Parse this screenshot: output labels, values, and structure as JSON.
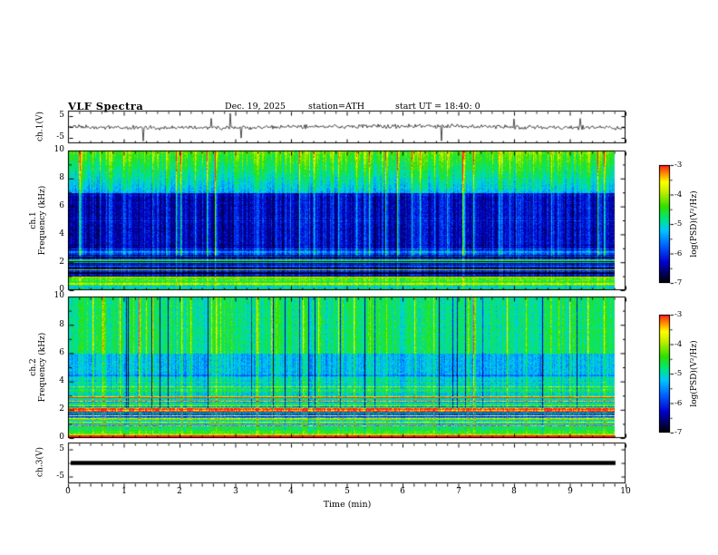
{
  "title": "VLF Spectra",
  "header": {
    "date": "Dec. 19, 2025",
    "station": "station=ATH",
    "start_ut": "start UT =  18:40: 0"
  },
  "x_axis": {
    "label": "Time (min)",
    "min": 0,
    "max": 10,
    "ticks": [
      "0",
      "1",
      "2",
      "3",
      "4",
      "5",
      "6",
      "7",
      "8",
      "9",
      "10"
    ]
  },
  "panels": [
    {
      "id": "ch1-waveform",
      "ylabel": "ch.1(V)",
      "ytick_top": "5",
      "ytick_bottom": "-5",
      "y_min": -5,
      "y_max": 5
    },
    {
      "id": "ch1-spectrogram",
      "name": "ch.1",
      "ylabel": "Frequency (kHz)",
      "yticks": [
        "10",
        "8",
        "6",
        "4",
        "2",
        "0"
      ],
      "f_min": 0,
      "f_max": 10
    },
    {
      "id": "ch2-spectrogram",
      "name": "ch.2",
      "ylabel": "Frequency (kHz)",
      "yticks": [
        "10",
        "8",
        "6",
        "4",
        "2",
        "0"
      ],
      "f_min": 0,
      "f_max": 10
    },
    {
      "id": "ch3-waveform",
      "ylabel": "ch.3(V)",
      "ytick_top": "5",
      "ytick_bottom": "-5",
      "y_min": -5,
      "y_max": 5,
      "value": 0
    }
  ],
  "colorbar": {
    "label": "log(PSD)(V²/Hz)",
    "ticks": [
      "-3",
      "-4",
      "-5",
      "-6",
      "-7"
    ],
    "z_min": -7,
    "z_max": -3
  },
  "colors": {
    "background": "#ffffff",
    "frame": "#000000",
    "trace": "#000000"
  },
  "render": {
    "colormap_stops": [
      [
        0,
        "#000000"
      ],
      [
        0.07,
        "#00004a"
      ],
      [
        0.18,
        "#0000d0"
      ],
      [
        0.32,
        "#0060ff"
      ],
      [
        0.45,
        "#00c8ff"
      ],
      [
        0.55,
        "#00e878"
      ],
      [
        0.65,
        "#30e000"
      ],
      [
        0.78,
        "#c8f000"
      ],
      [
        0.86,
        "#ffff00"
      ],
      [
        0.94,
        "#ff8000"
      ],
      [
        1,
        "#ff2020"
      ]
    ],
    "seeds": {
      "ch1_wave": 42,
      "ch1_spec": 101,
      "ch2_spec": 202
    },
    "data_end_fraction": 0.982
  },
  "chart_data": [
    {
      "type": "line",
      "panel": "ch.1(V)",
      "xlabel": "Time (min)",
      "xlim": [
        0,
        10
      ],
      "ylim": [
        -5,
        5
      ],
      "description": "Black broadband waveform fluctuating near 0 V with many impulsive spikes reaching toward ±5 V across the full 0–10 min record"
    },
    {
      "type": "heatmap",
      "panel": "ch.1 spectrogram",
      "xlabel": "Time (min)",
      "ylabel": "Frequency (kHz)",
      "xlim": [
        0,
        10
      ],
      "ylim": [
        0,
        10
      ],
      "zlabel": "log(PSD)(V²/Hz)",
      "zlim": [
        -7,
        -3
      ],
      "description": "Dark-blue background (≈ -6.5) from 3–7 kHz, green/yellow band above 7 kHz with red speckles, dense vertical sferic streaks spanning mid-to-high frequencies, bright horizontal striations below 3 kHz; data ends near 9.8 min"
    },
    {
      "type": "heatmap",
      "panel": "ch.2 spectrogram",
      "xlabel": "Time (min)",
      "ylabel": "Frequency (kHz)",
      "xlim": [
        0,
        10
      ],
      "ylim": [
        0,
        10
      ],
      "zlabel": "log(PSD)(V²/Hz)",
      "zlim": [
        -7,
        -3
      ],
      "description": "Cyan/green background (≈ -5) with yellow vertical streaks above 6 kHz and occasional dark vertical gaps, strong horizontal banding below 4 kHz including an orange/red line near 2 kHz and a bright band near 0 kHz; data ends near 9.8 min"
    },
    {
      "type": "line",
      "panel": "ch.3(V)",
      "xlabel": "Time (min)",
      "xlim": [
        0,
        10
      ],
      "ylim": [
        -5,
        5
      ],
      "description": "Constant flat signal at 0 V drawn as a thick black line ending near 9.8 min"
    }
  ]
}
